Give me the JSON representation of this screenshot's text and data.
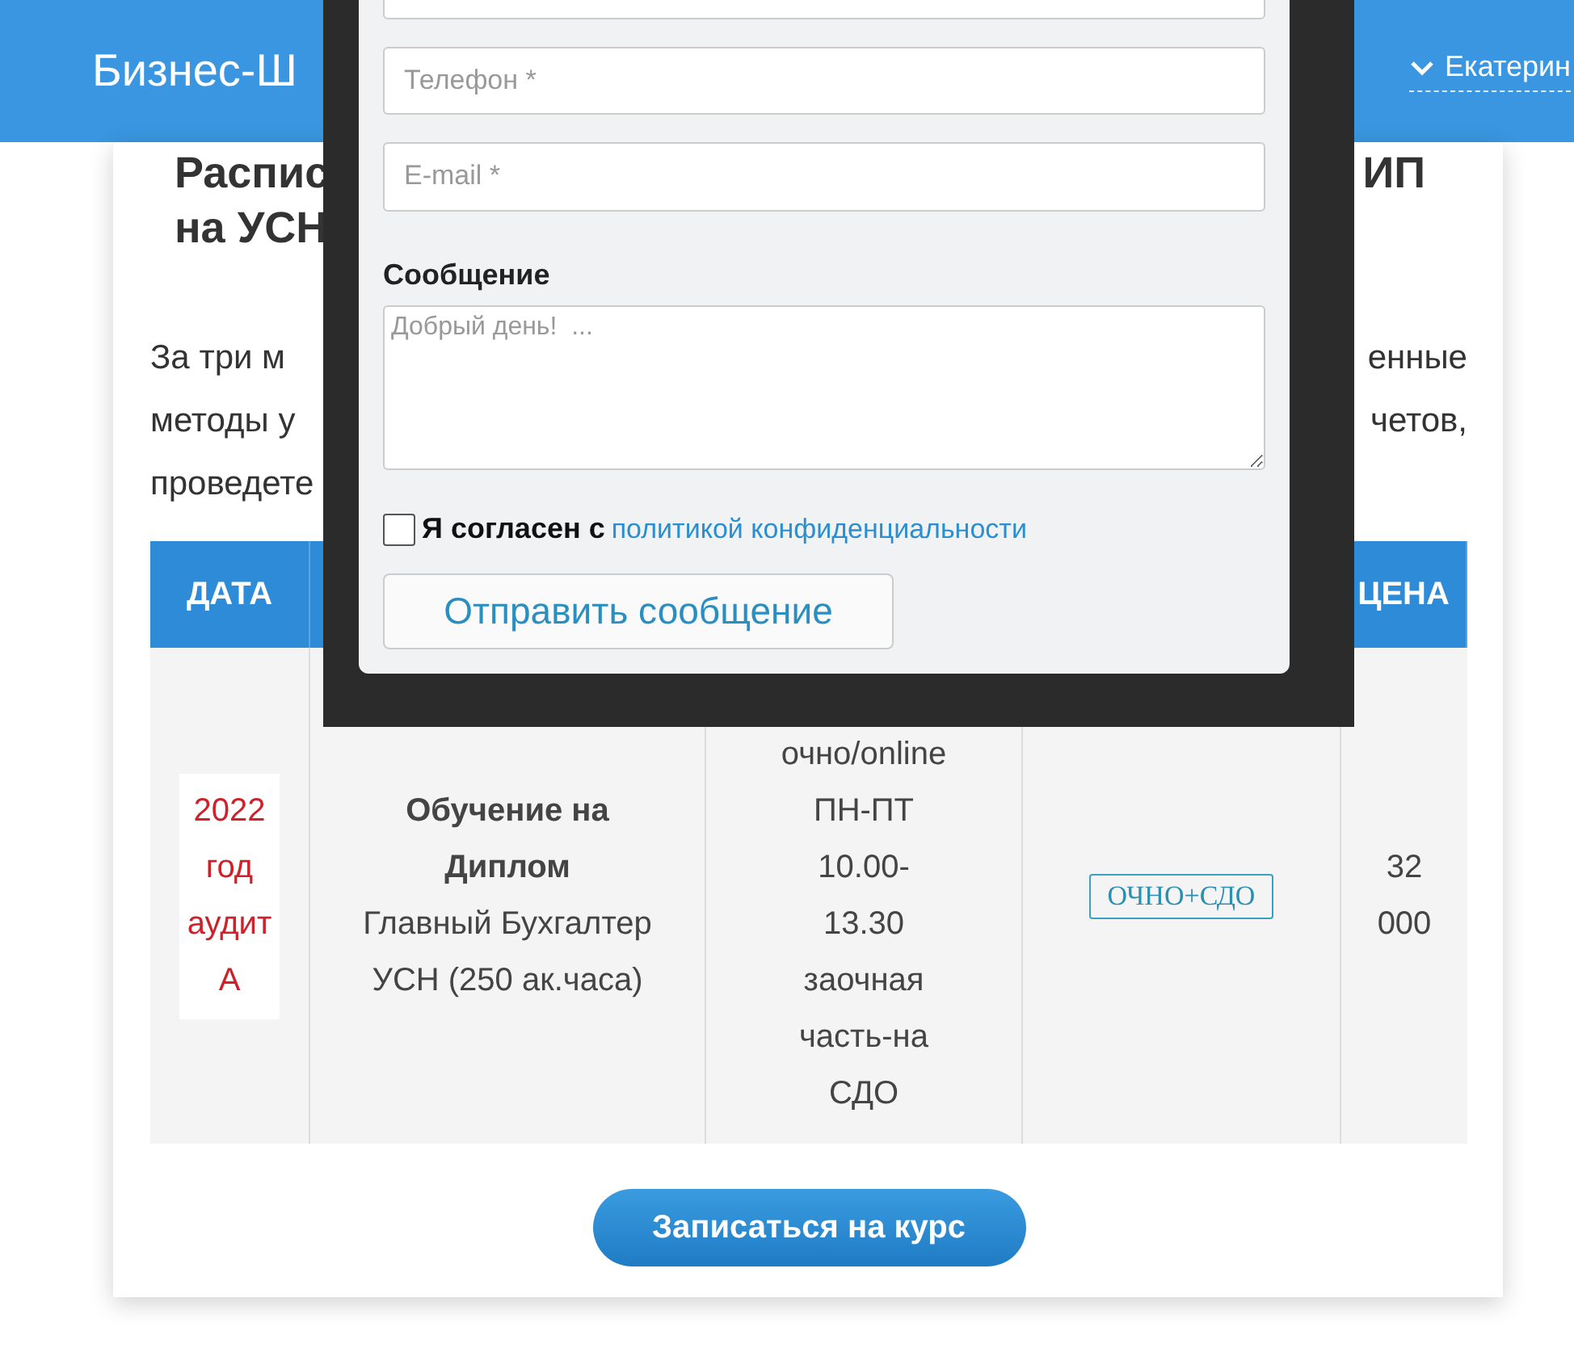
{
  "header": {
    "logo": "Бизнес-Ш",
    "user": "Екатерин"
  },
  "heading": {
    "left_lines": [
      "Распис",
      "на УСН"
    ],
    "right_lines": [
      "ИП"
    ]
  },
  "intro_lines": [
    {
      "left": "За три м",
      "right": "енные"
    },
    {
      "left": "методы у",
      "right": "четов,"
    },
    {
      "left": "проведете"
    }
  ],
  "table": {
    "column_1": "ДАТА",
    "column_5": "ЦЕНА",
    "rows": [
      {
        "date": "2022 год аудит А",
        "course_title": "Обучение на Диплом",
        "course_text": "Главный Бухгалтер УСН  (250 ак.часа)",
        "schedule_lines": [
          "очно/online",
          "ПН-ПТ",
          "10.00-",
          "13.30",
          "заочная",
          "часть-на",
          "СДО"
        ],
        "format": "ОЧНО+СДО",
        "price_lines": [
          "32",
          "000"
        ]
      }
    ]
  },
  "enroll_button": "Записаться на курс",
  "modal": {
    "fields": [
      {
        "placeholder": "Телефон *"
      },
      {
        "placeholder": "E-mail *"
      }
    ],
    "message_label": "Сообщение",
    "message_placeholder": "Добрый день!  ...",
    "consent": {
      "checked": false,
      "text": "Я согласен с",
      "link": "политикой конфиденциальности"
    },
    "submit": "Отправить сообщение"
  }
}
